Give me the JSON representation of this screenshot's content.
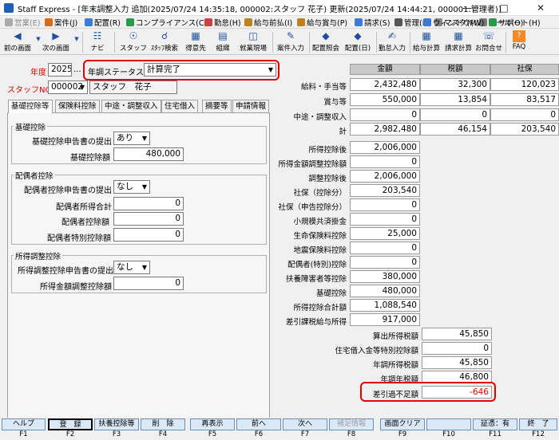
{
  "window": {
    "title": "Staff Express - [年末調整入力 追加(2025/07/24 14:35:18, 000002:スタッフ 花子) 更新(2025/07/24 14:44:21, 000001:管理者)]"
  },
  "menu": [
    "営業(E)",
    "案件(J)",
    "配置(R)",
    "コンプライアンス(C)",
    "勤怠(H)",
    "給与前払(I)",
    "給与賞与(P)",
    "請求(S)",
    "管理(D)",
    "マスタ(M)",
    "ツール(O)",
    "ウィンドウ(W)",
    "サポート(H)"
  ],
  "toolbar": [
    "前の画面",
    "次の画面",
    "ナビ",
    "スタッフ",
    "ｽﾀｯﾌ検索",
    "得意先",
    "組織",
    "就業現場",
    "案件入力",
    "配置照会",
    "配置(日)",
    "勤怠入力",
    "給与計算",
    "請求計算",
    "お問合せ",
    "FAQ"
  ],
  "header": {
    "year_label": "年度",
    "year_value": "2025",
    "year_ellipsis": "...",
    "status_label": "年調ステータス",
    "status_value": "計算完了",
    "staff_label": "スタッフNO",
    "staff_no": "000002",
    "staff_name": "スタッフ　花子"
  },
  "tabs": [
    "基礎控除等",
    "保険料控除",
    "中途・調整収入",
    "住宅借入",
    "摘要等",
    "申請情報"
  ],
  "left": {
    "kiso": {
      "title": "基礎控除",
      "decl_label": "基礎控除申告書の提出",
      "decl_value": "あり",
      "amount_label": "基礎控除額",
      "amount_value": "480,000"
    },
    "haigu": {
      "title": "配偶者控除",
      "decl_label": "配偶者控除申告書の提出",
      "decl_value": "なし",
      "rows": [
        {
          "label": "配偶者所得合計",
          "value": "0"
        },
        {
          "label": "配偶者控除額",
          "value": "0"
        },
        {
          "label": "配偶者特別控除額",
          "value": "0"
        }
      ]
    },
    "chosei": {
      "title": "所得調整控除",
      "decl_label": "所得調整控除申告書の提出",
      "decl_value": "なし",
      "amount_label": "所得金額調整控除額",
      "amount_value": "0"
    }
  },
  "grid": {
    "headers": [
      "金額",
      "税額",
      "社保"
    ],
    "rows": [
      {
        "label": "給料・手当等",
        "amount": "2,432,480",
        "tax": "32,300",
        "shaho": "120,023"
      },
      {
        "label": "賞与等",
        "amount": "550,000",
        "tax": "13,854",
        "shaho": "83,517"
      },
      {
        "label": "中途・調整収入",
        "amount": "0",
        "tax": "0",
        "shaho": "0"
      },
      {
        "label": "計",
        "amount": "2,982,480",
        "tax": "46,154",
        "shaho": "203,540"
      }
    ]
  },
  "calc": [
    {
      "label": "所得控除後",
      "value": "2,006,000"
    },
    {
      "label": "所得金額調整控除額",
      "value": "0"
    },
    {
      "label": "調整控除後",
      "value": "2,006,000"
    },
    {
      "label": "社保（控除分）",
      "value": "203,540"
    },
    {
      "label": "社保（申告控除分）",
      "value": "0"
    },
    {
      "label": "小規模共済掛金",
      "value": "0"
    },
    {
      "label": "生命保険料控除",
      "value": "25,000"
    },
    {
      "label": "地震保険料控除",
      "value": "0"
    },
    {
      "label": "配偶者(特別)控除",
      "value": "0"
    },
    {
      "label": "扶養障害者等控除",
      "value": "380,000"
    },
    {
      "label": "基礎控除",
      "value": "480,000"
    },
    {
      "label": "所得控除合計額",
      "value": "1,088,540"
    },
    {
      "label": "差引課税給与所得",
      "value": "917,000"
    }
  ],
  "tax": [
    {
      "label": "算出所得税額",
      "value": "45,850"
    },
    {
      "label": "住宅借入金等特別控除額",
      "value": "0"
    },
    {
      "label": "年調所得税額",
      "value": "45,850"
    },
    {
      "label": "年調年税額",
      "value": "46,800"
    },
    {
      "label": "差引過不足額",
      "value": "-646"
    }
  ],
  "fkeys": [
    {
      "label": "ヘルプ",
      "key": "F1"
    },
    {
      "label": "登　録",
      "key": "F2"
    },
    {
      "label": "扶養控除等",
      "key": "F3"
    },
    {
      "label": "削　除",
      "key": "F4"
    },
    {
      "label": "再表示",
      "key": "F5"
    },
    {
      "label": "前へ",
      "key": "F6"
    },
    {
      "label": "次へ",
      "key": "F7"
    },
    {
      "label": "補足情報",
      "key": "F8"
    },
    {
      "label": "画面クリア",
      "key": "F9"
    },
    {
      "label": "",
      "key": "F10"
    },
    {
      "label": "証憑：有",
      "key": "F11"
    },
    {
      "label": "終　了",
      "key": "F12"
    }
  ],
  "colors": {
    "highlight": "#e00000",
    "negative": "#e00000",
    "grid_header": "#c8c8c8",
    "fkey_bg": "#dbe8f6"
  }
}
